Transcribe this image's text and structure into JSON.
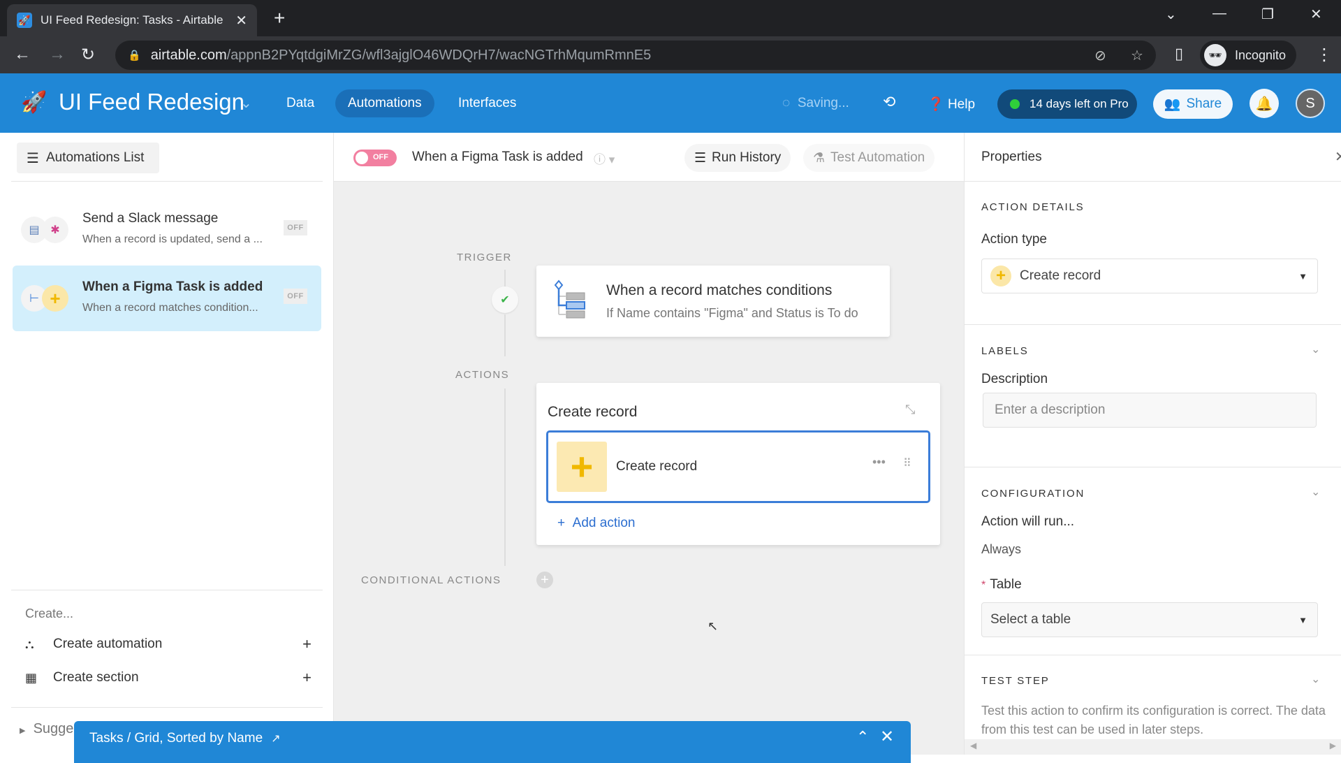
{
  "browser": {
    "tab_title": "UI Feed Redesign: Tasks - Airtable",
    "url_domain": "airtable.com",
    "url_path": "/appnB2PYqtdgiMrZG/wfl3ajglO46WDQrH7/wacNGTrhMqumRmnE5",
    "profile_label": "Incognito"
  },
  "header": {
    "base_name": "UI Feed Redesign",
    "nav": [
      {
        "label": "Data",
        "active": false
      },
      {
        "label": "Automations",
        "active": true
      },
      {
        "label": "Interfaces",
        "active": false
      }
    ],
    "saving_label": "Saving...",
    "help_label": "Help",
    "trial_label": "14 days left on Pro",
    "share_label": "Share",
    "avatar_initial": "S",
    "colors": {
      "header_bg": "#2087d6",
      "trial_dot": "#2fd03a"
    }
  },
  "sidebar": {
    "list_button": "Automations List",
    "automations": [
      {
        "name": "Send a Slack message",
        "description": "When a record is updated, send a ...",
        "status": "OFF",
        "selected": false
      },
      {
        "name": "When a Figma Task is added",
        "description": "When a record matches condition...",
        "status": "OFF",
        "selected": true
      }
    ],
    "create_label": "Create...",
    "create_items": [
      {
        "label": "Create automation"
      },
      {
        "label": "Create section"
      }
    ],
    "suggestions_label": "Suggestions"
  },
  "canvas_header": {
    "toggle_label": "OFF",
    "automation_title": "When a Figma Task is added",
    "run_history_label": "Run History",
    "test_automation_label": "Test Automation"
  },
  "canvas": {
    "trigger_label": "TRIGGER",
    "actions_label": "ACTIONS",
    "conditional_label": "CONDITIONAL ACTIONS",
    "trigger": {
      "title": "When a record matches conditions",
      "subtitle": "If Name contains \"Figma\" and Status is To do"
    },
    "action_group_title": "Create record",
    "action_step_label": "Create record",
    "add_action_label": "Add action"
  },
  "bottom_bar": {
    "label": "Tasks / Grid, Sorted by Name"
  },
  "properties": {
    "title": "Properties",
    "action_details_heading": "ACTION DETAILS",
    "action_type_label": "Action type",
    "action_type_value": "Create record",
    "labels_heading": "LABELS",
    "description_label": "Description",
    "description_placeholder": "Enter a description",
    "description_value": "",
    "configuration_heading": "CONFIGURATION",
    "action_will_run_label": "Action will run...",
    "action_will_run_value": "Always",
    "table_label": "Table",
    "table_placeholder": "Select a table",
    "test_step_heading": "TEST STEP",
    "test_step_text": "Test this action to confirm its configuration is correct. The data from this test can be used in later steps."
  }
}
